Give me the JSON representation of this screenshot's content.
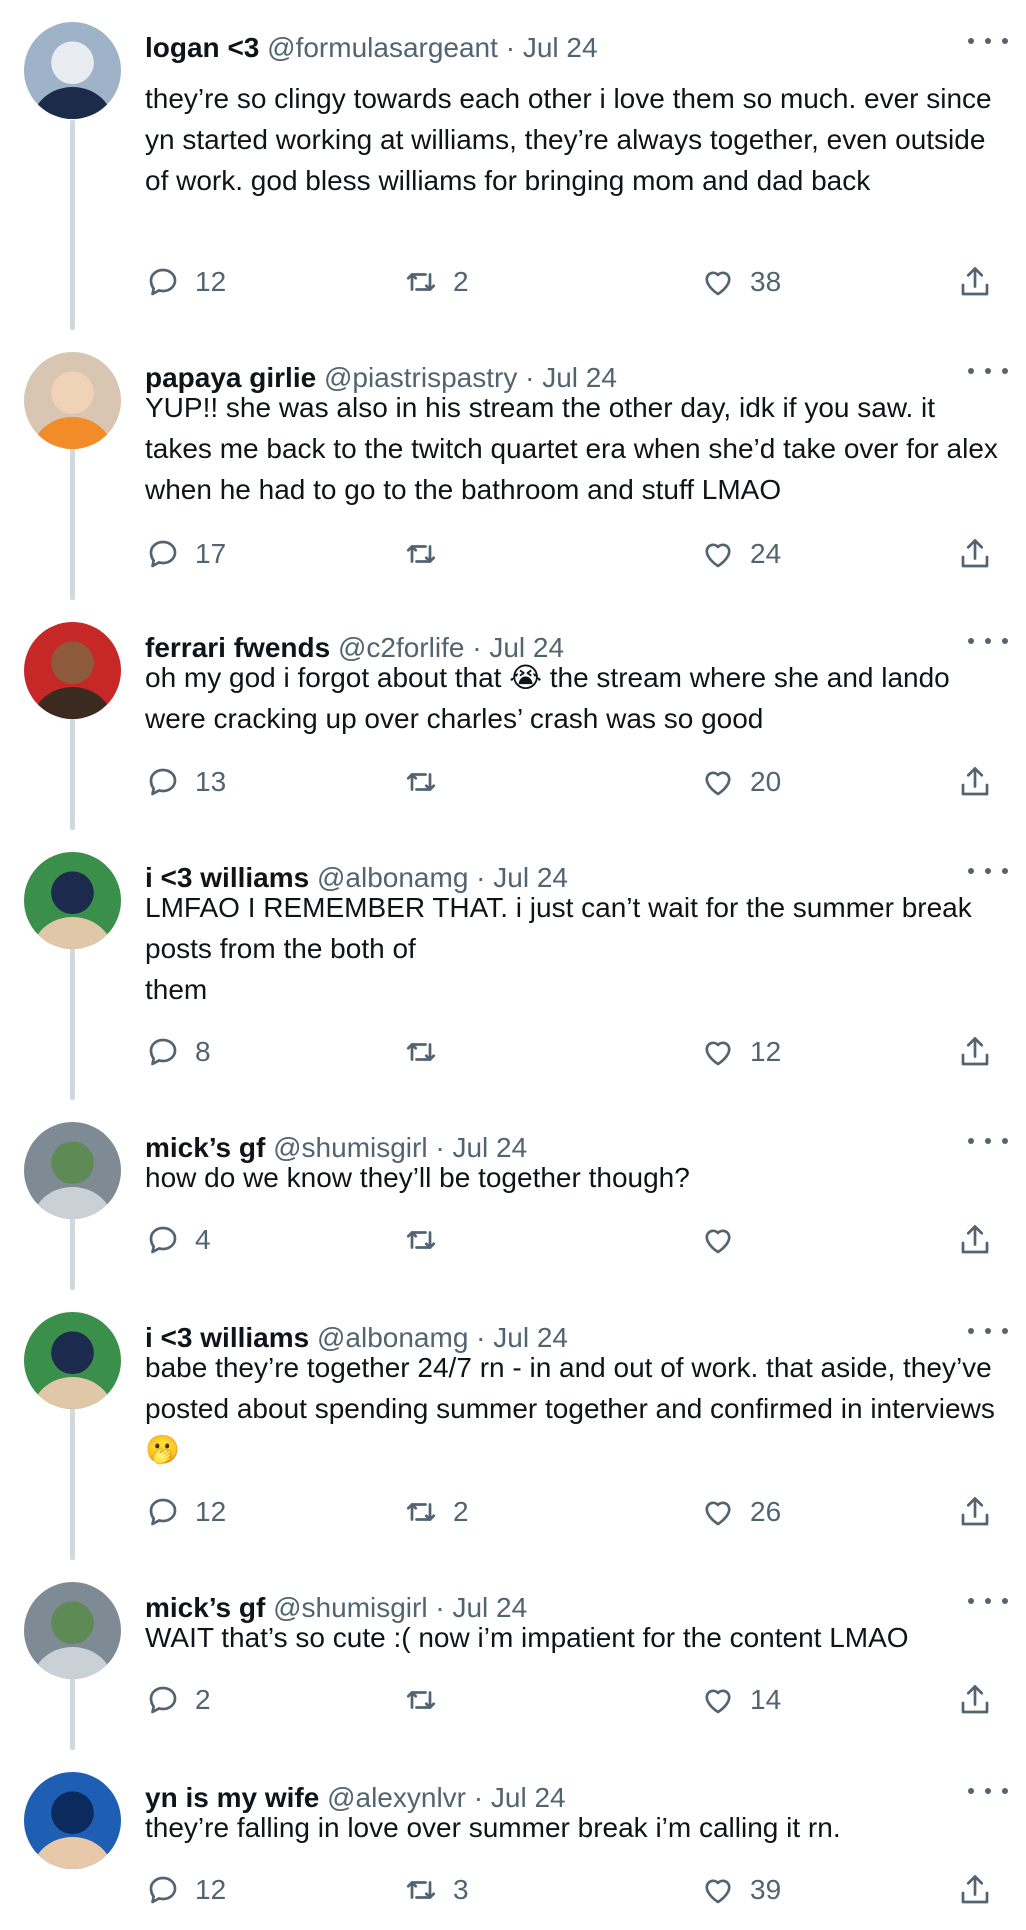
{
  "tweets": [
    {
      "name": "logan <3",
      "handle": "@formulasargeant",
      "date": "Jul 24",
      "text": "they’re so clingy towards each other i love them so much. ever since yn started working at williams, they’re always together, even outside of work. god bless williams for bringing mom and dad back",
      "replies": "12",
      "retweets": "2",
      "likes": "38",
      "avatar_colors": [
        "#9fb3c8",
        "#e9edf1",
        "#1d2b4a"
      ]
    },
    {
      "name": "papaya girlie",
      "handle": "@piastrispastry",
      "date": "Jul 24",
      "text": "YUP!! she was also in his stream the other day, idk if you saw. it takes me back to the twitch quartet era when she’d take over for alex when he had to go to the bathroom and stuff LMAO",
      "replies": "17",
      "retweets": "",
      "likes": "24",
      "avatar_colors": [
        "#d8c6b2",
        "#f0d2b6",
        "#f28c28"
      ]
    },
    {
      "name": "ferrari fwends",
      "handle": "@c2forlife",
      "date": "Jul 24",
      "text": "oh my god i forgot about that 😭 the stream where she and lando were cracking up over charles’ crash was so good",
      "replies": "13",
      "retweets": "",
      "likes": "20",
      "avatar_colors": [
        "#c62828",
        "#8d5a3c",
        "#3b2a20"
      ]
    },
    {
      "name": "i <3 williams",
      "handle": "@albonamg",
      "date": "Jul 24",
      "text": "LMFAO I REMEMBER THAT. i just can’t wait for the summer break posts from the both of\nthem",
      "replies": "8",
      "retweets": "",
      "likes": "12",
      "avatar_colors": [
        "#3a8f4a",
        "#1c2a4d",
        "#e0c7a8"
      ]
    },
    {
      "name": "mick’s gf",
      "handle": "@shumisgirl",
      "date": "Jul 24",
      "text": "how do we know they’ll be together though?",
      "replies": "4",
      "retweets": "",
      "likes": "",
      "avatar_colors": [
        "#7f8b94",
        "#5d8a55",
        "#c9d1d6"
      ]
    },
    {
      "name": "i <3 williams",
      "handle": "@albonamg",
      "date": "Jul 24",
      "text": "babe they’re together 24/7 rn - in and out of work. that aside, they’ve posted about spending summer together and confirmed in interviews 🫢",
      "replies": "12",
      "retweets": "2",
      "likes": "26",
      "avatar_colors": [
        "#3a8f4a",
        "#1c2a4d",
        "#e0c7a8"
      ]
    },
    {
      "name": "mick’s gf",
      "handle": "@shumisgirl",
      "date": "Jul 24",
      "text": "WAIT that’s so cute :( now i’m impatient for the content LMAO",
      "replies": "2",
      "retweets": "",
      "likes": "14",
      "avatar_colors": [
        "#7f8b94",
        "#5d8a55",
        "#c9d1d6"
      ]
    },
    {
      "name": "yn is my wife",
      "handle": "@alexynlvr",
      "date": "Jul 24",
      "text": "they’re falling in love over summer break i’m calling it rn.",
      "replies": "12",
      "retweets": "3",
      "likes": "39",
      "avatar_colors": [
        "#1e5fb3",
        "#0b2a5e",
        "#e7c9a9"
      ]
    }
  ],
  "icons": {
    "reply": "reply-icon",
    "retweet": "retweet-icon",
    "like": "heart-icon",
    "share": "share-icon",
    "more": "more-icon"
  },
  "colors": {
    "text": "#0f1419",
    "secondary": "#536471",
    "thread_line": "#cfd9de"
  }
}
